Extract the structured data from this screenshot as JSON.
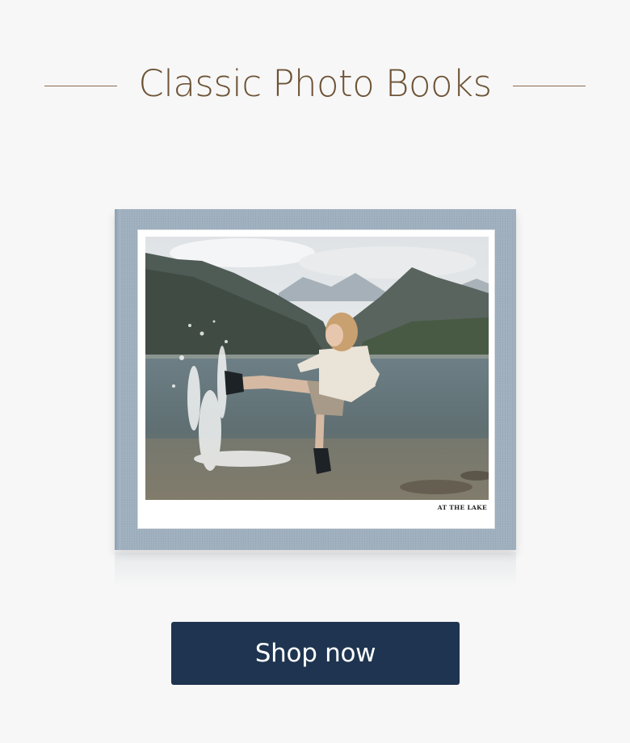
{
  "header": {
    "title": "Classic Photo Books"
  },
  "book": {
    "cover_color": "#9fb0bf",
    "caption": "AT THE LAKE",
    "photo_icon": "photo-lake-kick"
  },
  "cta": {
    "label": "Shop now",
    "color": "#1e3450"
  }
}
